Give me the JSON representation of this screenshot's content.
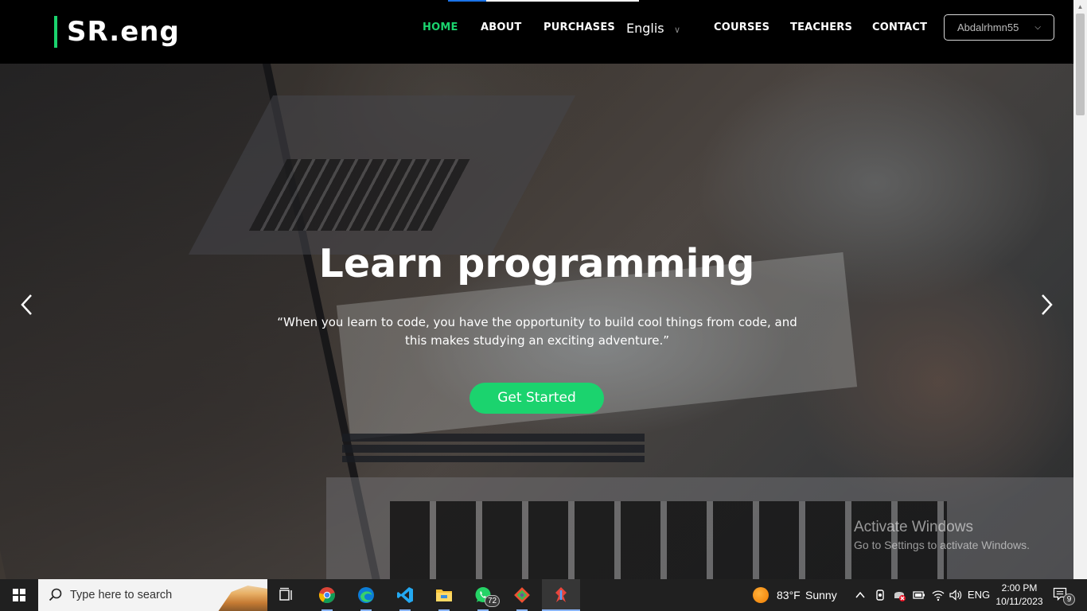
{
  "navbar": {
    "logo": "SR.eng",
    "links": [
      {
        "label": "HOME",
        "active": true
      },
      {
        "label": "ABOUT",
        "active": false
      },
      {
        "label": "PURCHASES",
        "active": false
      },
      {
        "label": "COURSES",
        "active": false
      },
      {
        "label": "TEACHERS",
        "active": false
      },
      {
        "label": "CONTACT",
        "active": false
      }
    ],
    "language": "Englis",
    "user": "Abdalrhmn55"
  },
  "hero": {
    "title": "Learn programming",
    "quote": "“When you learn to code, you have the opportunity to build cool things from code, and this makes studying an exciting adventure.”",
    "cta": "Get Started"
  },
  "watermark": {
    "heading": "Activate Windows",
    "sub": "Go to Settings to activate Windows."
  },
  "taskbar": {
    "search_placeholder": "Type here to search",
    "whatsapp_badge": "72",
    "weather_temp": "83°F",
    "weather_cond": "Sunny",
    "language": "ENG",
    "time": "2:00 PM",
    "date": "10/11/2023",
    "notification_count": "9"
  },
  "colors": {
    "accent": "#1bd36e",
    "navbar_bg": "#000000",
    "taskbar_bg": "#202020"
  }
}
